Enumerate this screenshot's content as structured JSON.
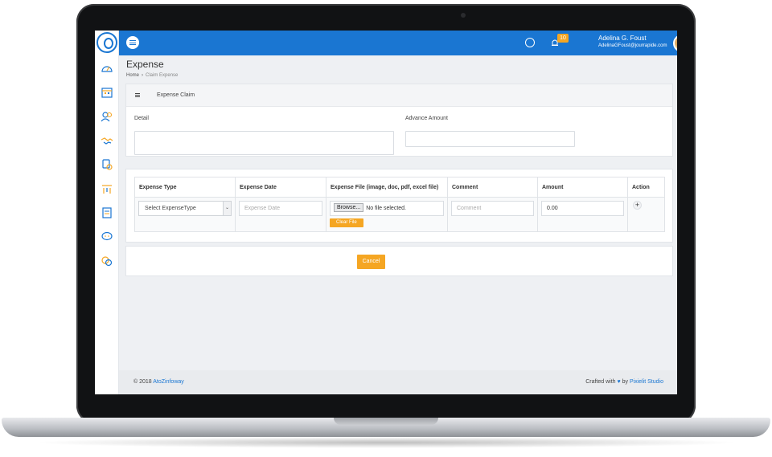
{
  "header": {
    "notification_count": "10",
    "user_name": "Adelina G. Foust",
    "user_email": "AdelinaGFoust@jourrapide.com"
  },
  "sidebar": {
    "icons": [
      "dashboard-icon",
      "calendar-icon",
      "users-icon",
      "handshake-icon",
      "money-icon",
      "chart-icon",
      "document-icon",
      "chat-icon",
      "settings-icon"
    ]
  },
  "page": {
    "title": "Expense",
    "breadcrumb": [
      "Home",
      "Claim Expense"
    ]
  },
  "claim_card": {
    "header": "Expense Claim",
    "detail_label": "Detail",
    "detail_value": "",
    "advance_label": "Advance Amount",
    "advance_value": ""
  },
  "expense_table": {
    "columns": [
      "Expense Type",
      "Expense Date",
      "Expense File (image, doc, pdf, excel file)",
      "Comment",
      "Amount",
      "Action"
    ],
    "row": {
      "expense_type": "Select ExpenseType",
      "expense_date_placeholder": "Expense Date",
      "browse_label": "Browse...",
      "file_status": "No file selected.",
      "clear_file_label": "Clear File",
      "comment_placeholder": "Comment",
      "amount": "0.00",
      "add_label": "+"
    }
  },
  "actions": {
    "cancel_label": "Cancel"
  },
  "footer": {
    "copyright": "© 2018",
    "company": "AtoZinfoway",
    "crafted": "Crafted with",
    "by": "by",
    "studio": "Pixielit Studio"
  },
  "colors": {
    "primary": "#1a76d2",
    "accent": "#f5a623",
    "icon_orange": "#f5a623",
    "icon_blue": "#1a76d2"
  }
}
